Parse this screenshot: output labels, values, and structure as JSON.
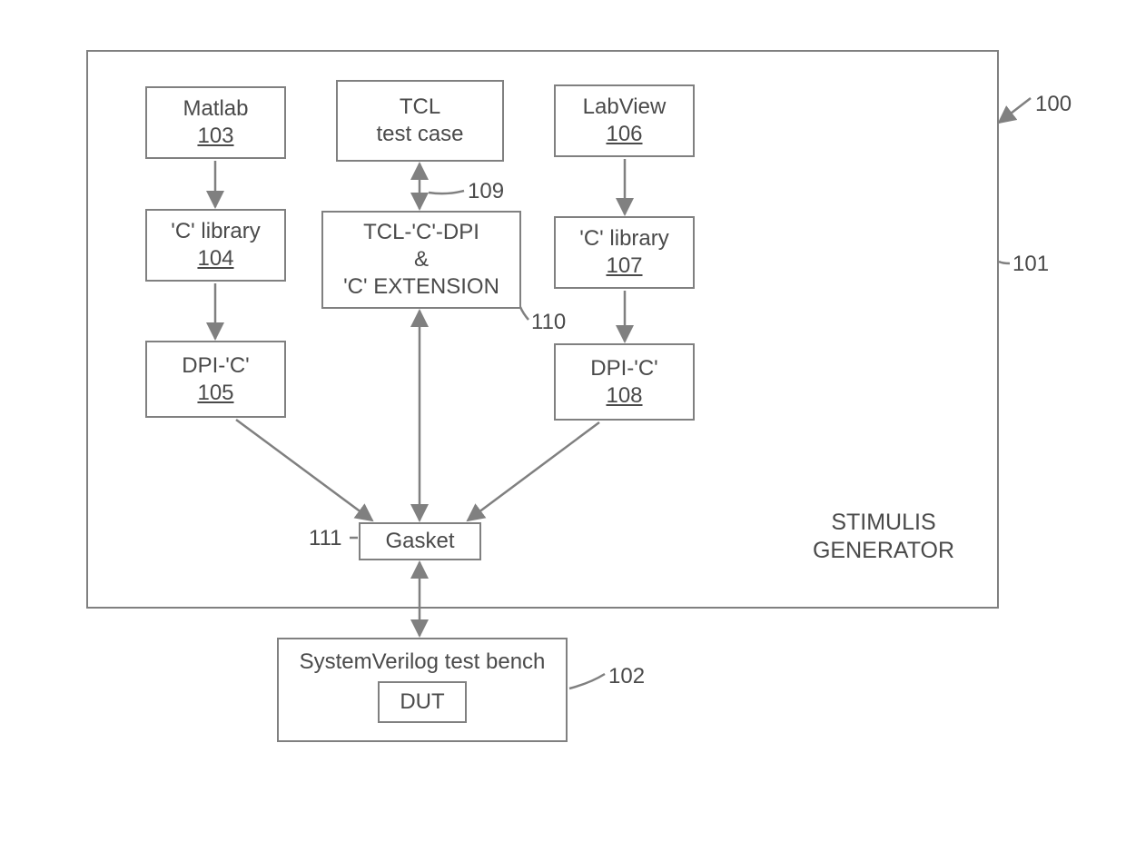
{
  "outer": {
    "title": "STIMULIS GENERATOR"
  },
  "blocks": {
    "matlab": {
      "label": "Matlab",
      "ref": "103"
    },
    "clib_left": {
      "label": "'C' library",
      "ref": "104"
    },
    "dpic_left": {
      "label": "DPI-'C'",
      "ref": "105"
    },
    "tcl_test": {
      "label1": "TCL",
      "label2": "test case"
    },
    "tcl_ext": {
      "label1": "TCL-'C'-DPI",
      "label2": "&",
      "label3": "'C' EXTENSION"
    },
    "labview": {
      "label": "LabView",
      "ref": "106"
    },
    "clib_right": {
      "label": "'C' library",
      "ref": "107"
    },
    "dpic_right": {
      "label": "DPI-'C'",
      "ref": "108"
    },
    "gasket": {
      "label": "Gasket"
    },
    "svtb": {
      "label": "SystemVerilog test bench",
      "inner": "DUT"
    }
  },
  "refs": {
    "r100": "100",
    "r101": "101",
    "r102": "102",
    "r109": "109",
    "r110": "110",
    "r111": "111"
  }
}
